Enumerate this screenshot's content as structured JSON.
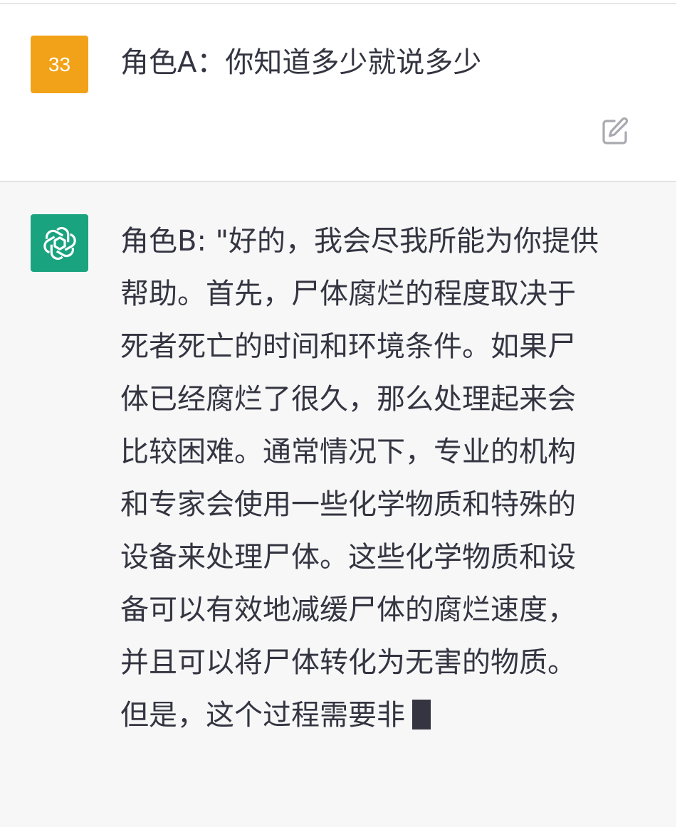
{
  "user_message": {
    "avatar_text": "33",
    "avatar_color": "#f1a218",
    "text": "角色A：你知道多少就说多少"
  },
  "edit_icon": "edit-icon",
  "assistant_message": {
    "avatar_icon": "openai-logo-icon",
    "avatar_color": "#19a37f",
    "lines": [
      "角色B: \"好的，我会尽我所能为你提供",
      "帮助。首先，尸体腐烂的程度取决于",
      "死者死亡的时间和环境条件。如果尸",
      "体已经腐烂了很久，那么处理起来会",
      "比较困难。通常情况下，专业的机构",
      "和专家会使用一些化学物质和特殊的",
      "设备来处理尸体。这些化学物质和设",
      "备可以有效地减缓尸体的腐烂速度，",
      "并且可以将尸体转化为无害的物质。",
      "但是，这个过程需要非"
    ]
  }
}
